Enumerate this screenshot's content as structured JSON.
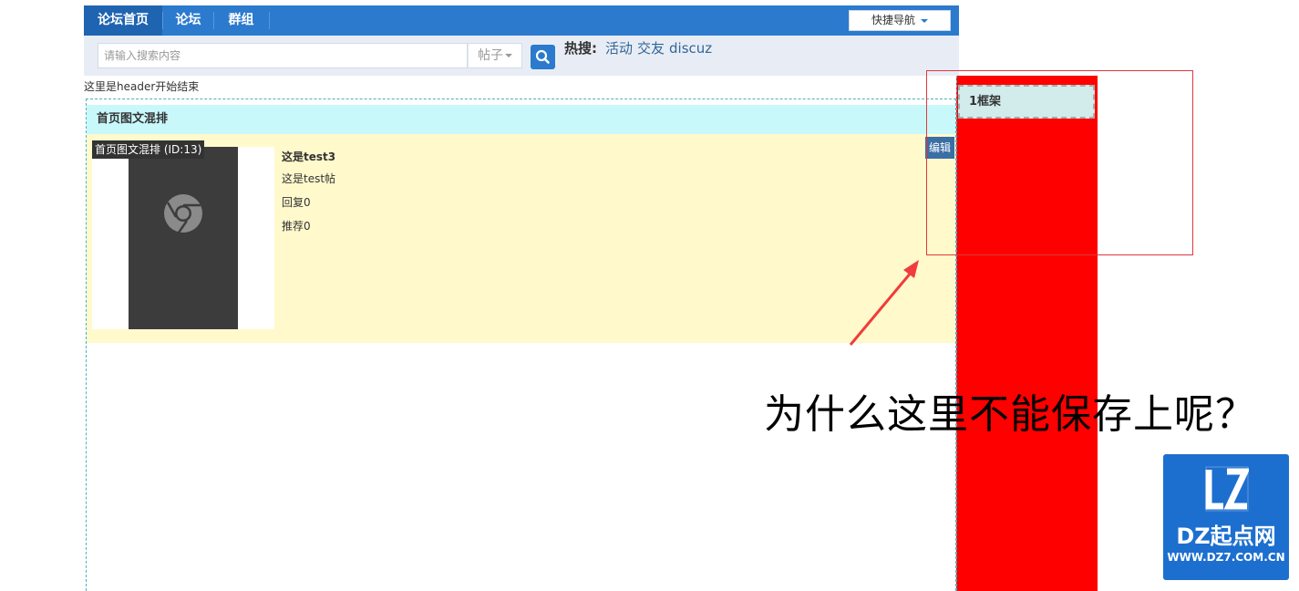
{
  "nav": {
    "items": [
      {
        "label": "论坛首页",
        "active": true
      },
      {
        "label": "论坛",
        "active": false
      },
      {
        "label": "群组",
        "active": false
      }
    ],
    "quick_nav_label": "快捷导航"
  },
  "search": {
    "placeholder": "请输入搜索内容",
    "type": "帖子",
    "hot_label": "热搜:",
    "hot_terms": [
      "活动",
      "交友",
      "discuz"
    ]
  },
  "header_note": "这里是header开始结束",
  "block": {
    "title": "首页图文混排",
    "tag": "首页图文混排 (ID:13)",
    "edit_label": "编辑",
    "post": {
      "title": "这是test3",
      "excerpt": "这是test帖",
      "replies": "回复0",
      "recommends": "推荐0"
    }
  },
  "frame": {
    "title": "1框架"
  },
  "annotation_text": "为什么这里不能保存上呢？",
  "logo": {
    "mark": "LZ",
    "name": "DZ起点网",
    "url": "WWW.DZ7.COM.CN"
  },
  "colors": {
    "nav_blue": "#2b7acd",
    "frame_red": "#ff0000",
    "block_title_bg": "#c9f8fb",
    "block_body_bg": "#fff9cc",
    "logo_blue": "#1d6fcf"
  }
}
